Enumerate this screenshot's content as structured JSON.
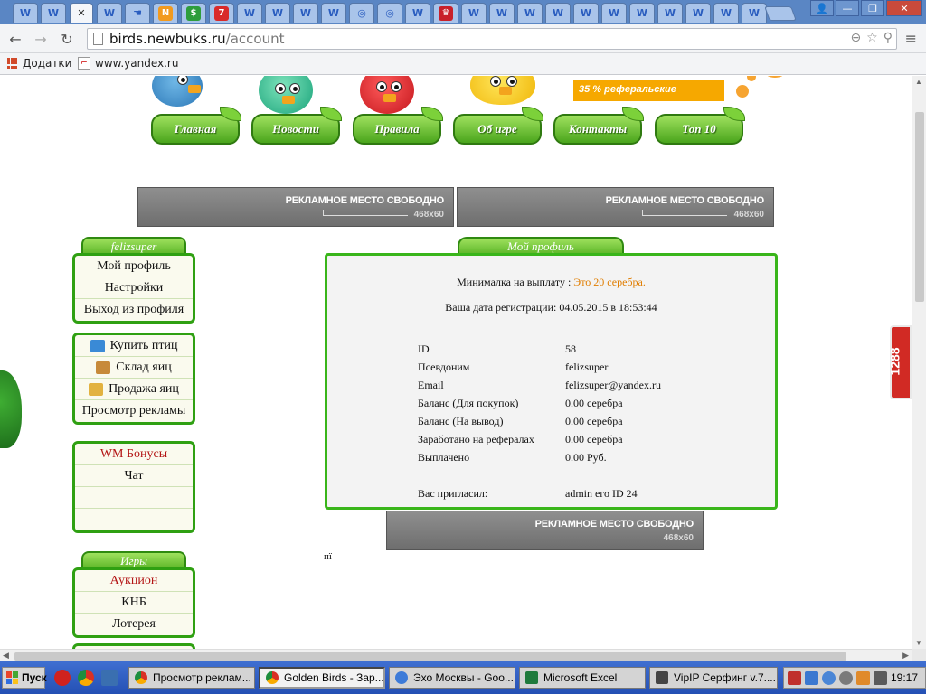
{
  "browser": {
    "address": {
      "host": "birds.newbuks.ru",
      "path": "/account"
    },
    "bookmarks": [
      {
        "label": "Додатки",
        "icon": "apps-grid-icon"
      },
      {
        "label": "www.yandex.ru",
        "icon": "bookmark-page-icon"
      }
    ],
    "tab_icons": [
      "W",
      "W",
      "x",
      "W",
      "hand",
      "N",
      "$",
      "7",
      "W",
      "W",
      "W",
      "W",
      "owl",
      "owl",
      "W",
      "crown",
      "W",
      "W",
      "W",
      "W",
      "W",
      "W",
      "W",
      "W",
      "W",
      "W",
      "W"
    ]
  },
  "site": {
    "referral_banner": "35 % реферальские",
    "nav": [
      "Главная",
      "Новости",
      "Правила",
      "Об игре",
      "Контакты",
      "Топ 10"
    ],
    "ads": [
      {
        "title": "РЕКЛАМНОЕ МЕСТО СВОБОДНО",
        "size": "468x60"
      },
      {
        "title": "РЕКЛАМНОЕ МЕСТО СВОБОДНО",
        "size": "468x60"
      },
      {
        "title": "РЕКЛАМНОЕ МЕСТО СВОБОДНО",
        "size": "468x60"
      }
    ],
    "sidebar": {
      "user_tab": "felizsuper",
      "account_menu": [
        "Мой профиль",
        "Настройки",
        "Выход из профиля"
      ],
      "shop_menu": [
        "Купить птиц",
        "Склад яиц",
        "Продажа яиц",
        "Просмотр рекламы"
      ],
      "bonus_menu": [
        "WM Бонусы",
        "Чат"
      ],
      "games_tab": "Игры",
      "games_menu": [
        "Аукцион",
        "КНБ",
        "Лотерея"
      ]
    },
    "profile": {
      "tab": "Мой профиль",
      "min_payout_label": "Минималка на выплату :",
      "min_payout_value": "Это 20 серебра.",
      "reg_date": "Ваша дата регистрации: 04.05.2015 в 18:53:44",
      "fields": [
        {
          "label": "ID",
          "value": "58"
        },
        {
          "label": "Псевдоним",
          "value": "felizsuper"
        },
        {
          "label": "Email",
          "value": "felizsuper@yandex.ru"
        },
        {
          "label": "Баланс (Для покупок)",
          "value": "0.00 серебра"
        },
        {
          "label": "Баланс (На вывод)",
          "value": "0.00 серебра"
        },
        {
          "label": "Заработано на рефералах",
          "value": "0.00 серебра"
        },
        {
          "label": "Выплачено",
          "value": "0.00 Руб."
        }
      ],
      "invited_label": "Вас пригласил:",
      "invited_value": "admin его ID 24"
    },
    "stray_text": "пї",
    "side_widget": "1288"
  },
  "taskbar": {
    "start": "Пуск",
    "tasks": [
      "Просмотр реклам...",
      "Golden Birds - Зар...",
      "Эхо Москвы - Goo...",
      "Microsoft Excel",
      "VipIP Серфинг v.7...."
    ],
    "clock": "19:17"
  },
  "colors": {
    "accent_green": "#39b51a",
    "highlight_orange": "#e07d00",
    "bonus_red": "#b31313",
    "ad_gray": "#7a7a7a",
    "taskbar_blue": "#2f5fc4"
  }
}
